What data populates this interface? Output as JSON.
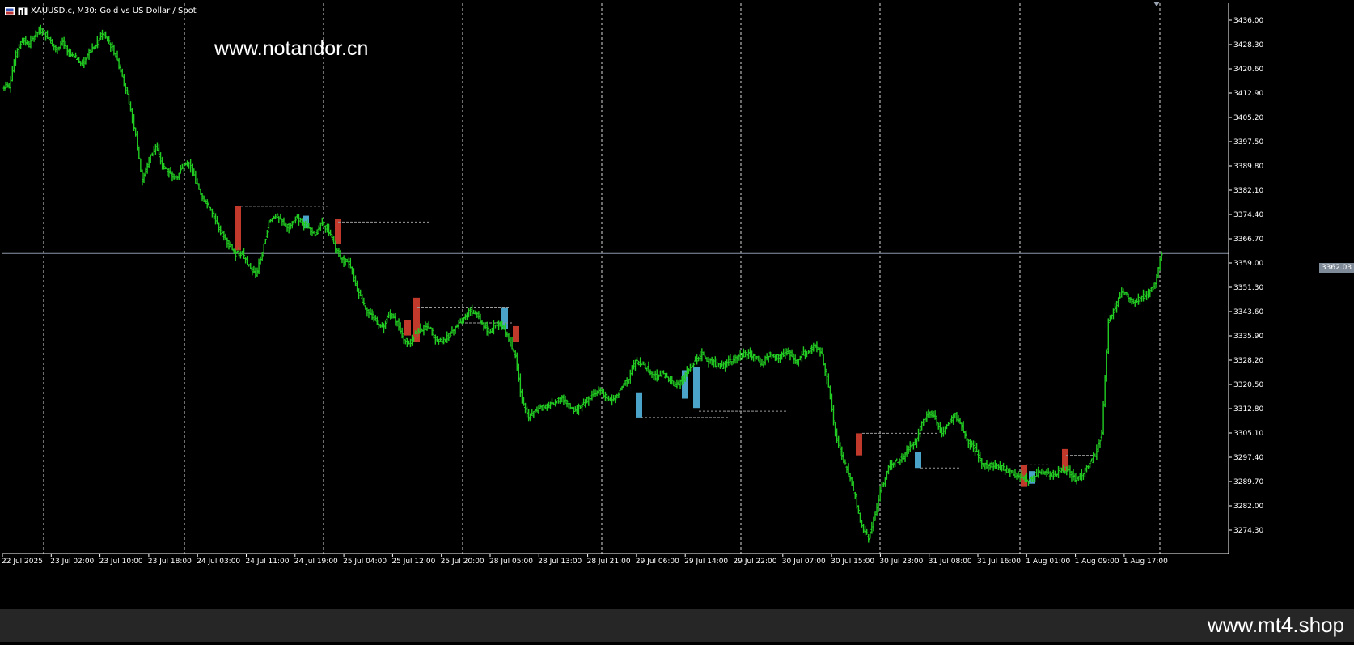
{
  "header": {
    "symbol_info": "XAUUSD.c, M30:  Gold vs US Dollar / Spot"
  },
  "watermarks": {
    "top": "www.notandor.cn",
    "bottom": "www.mt4.shop"
  },
  "colors": {
    "background": "#000000",
    "bar": "#22cc22",
    "grid": "#ffffff",
    "axis_text": "#ffffff",
    "current_price_line": "#8a96a8",
    "bearish_box": "#c0392b",
    "bullish_box": "#4aa3c8",
    "bottom_bar": "#262626"
  },
  "current_price": "3362.03",
  "chart_data": {
    "type": "line",
    "chart_kind": "ohlc-bars",
    "title": "XAUUSD.c, M30:  Gold vs US Dollar / Spot",
    "xlabel": "",
    "ylabel": "",
    "ylim": [
      3266.9,
      3440.0
    ],
    "grid": "vertical-dotted",
    "y_ticks": [
      "3436.00",
      "3428.30",
      "3420.60",
      "3412.90",
      "3405.20",
      "3397.50",
      "3389.80",
      "3382.10",
      "3374.40",
      "3366.70",
      "3359.00",
      "3351.30",
      "3343.60",
      "3335.90",
      "3328.20",
      "3320.50",
      "3312.80",
      "3305.10",
      "3297.40",
      "3289.70",
      "3282.00",
      "3274.30"
    ],
    "x_ticks": [
      "22 Jul 2025",
      "23 Jul 02:00",
      "23 Jul 10:00",
      "23 Jul 18:00",
      "24 Jul 03:00",
      "24 Jul 11:00",
      "24 Jul 19:00",
      "25 Jul 04:00",
      "25 Jul 12:00",
      "25 Jul 20:00",
      "28 Jul 05:00",
      "28 Jul 13:00",
      "28 Jul 21:00",
      "29 Jul 06:00",
      "29 Jul 14:00",
      "29 Jul 22:00",
      "30 Jul 07:00",
      "30 Jul 15:00",
      "30 Jul 23:00",
      "31 Jul 08:00",
      "31 Jul 16:00",
      "1 Aug 01:00",
      "1 Aug 09:00",
      "1 Aug 17:00"
    ],
    "series": [
      {
        "values": [
          3415,
          3425,
          3430,
          3428,
          3432,
          3433,
          3430,
          3427,
          3429,
          3425,
          3424,
          3422,
          3426,
          3428,
          3432,
          3429,
          3425,
          3418,
          3410,
          3400,
          3385,
          3392,
          3396,
          3390,
          3388,
          3386,
          3389,
          3391,
          3385,
          3380,
          3377,
          3372,
          3368,
          3365,
          3362,
          3362,
          3358,
          3355,
          3362,
          3372,
          3374,
          3372,
          3370,
          3373,
          3372,
          3370,
          3368,
          3372,
          3369,
          3364,
          3360,
          3359,
          3352,
          3347,
          3343,
          3341,
          3338,
          3343,
          3341,
          3336,
          3333,
          3337,
          3338,
          3339,
          3335,
          3334,
          3336,
          3339,
          3341,
          3344,
          3343,
          3340,
          3337,
          3340,
          3339,
          3335,
          3329,
          3315,
          3310,
          3312,
          3313,
          3314,
          3315,
          3316,
          3314,
          3312,
          3314,
          3316,
          3318,
          3318,
          3316,
          3316,
          3320,
          3322,
          3328,
          3327,
          3325,
          3323,
          3324,
          3322,
          3320,
          3322,
          3325,
          3328,
          3330,
          3328,
          3327,
          3326,
          3328,
          3329,
          3330,
          3330,
          3329,
          3327,
          3330,
          3329,
          3330,
          3331,
          3328,
          3330,
          3331,
          3333,
          3330,
          3320,
          3305,
          3298,
          3292,
          3285,
          3275,
          3272,
          3280,
          3288,
          3294,
          3296,
          3297,
          3300,
          3302,
          3308,
          3312,
          3310,
          3305,
          3308,
          3311,
          3307,
          3302,
          3300,
          3295,
          3295,
          3295,
          3294,
          3293,
          3292,
          3291,
          3290,
          3292,
          3293,
          3292,
          3292,
          3294,
          3293,
          3290,
          3292,
          3295,
          3298,
          3305,
          3340,
          3345,
          3350,
          3348,
          3347,
          3348,
          3350,
          3352,
          3362
        ]
      }
    ],
    "annotations": [
      "box",
      "box",
      "box",
      "box",
      "box",
      "box",
      "box",
      "box",
      "box",
      "box"
    ]
  }
}
